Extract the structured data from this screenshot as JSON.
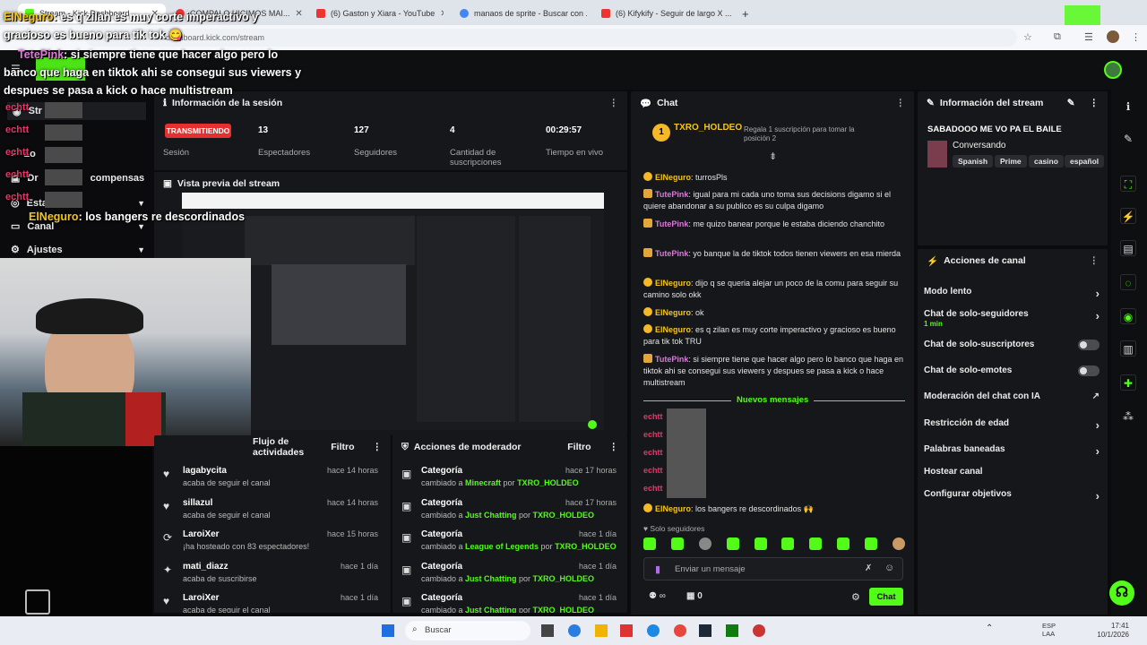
{
  "browser": {
    "tabs": [
      {
        "label": "Stream - Kick Dashboard",
        "color": "#53fc18"
      },
      {
        "label": "COMPALO HICIMOS MAI...",
        "color": "#e33"
      },
      {
        "label": "(6) Gaston y Xiara - YouTube",
        "color": "#e33"
      },
      {
        "label": "manaos de sprite - Buscar con ...",
        "color": "#4285f4"
      },
      {
        "label": "(6) Kifykify - Seguir de largo X ...",
        "color": "#e33"
      }
    ],
    "new_tab": "+",
    "url": "dashboard.kick.com/stream"
  },
  "overlay": {
    "line1_user": "ElNeguro",
    "line1_text": ": es q zilan es muy corte imperactivo y",
    "line2_text": "gracioso es bueno para tik tok",
    "line3_user": "TetePink",
    "line3_text": ": si siempre tiene que hacer algo pero lo",
    "line4_text": "banco que haga en tiktok ahi se consegui sus viewers y",
    "line5_text": "despues se pasa a kick o hace multistream",
    "line6_user": "ElNeguro",
    "line6_text": ": los bangers re descordinados",
    "spam_user": "echtt"
  },
  "leftnav": {
    "items": [
      {
        "label": "Str"
      },
      {
        "label": "Lo"
      },
      {
        "label": "Dr",
        "suffix": "compensas"
      },
      {
        "label": "Estado"
      },
      {
        "label": "Canal"
      },
      {
        "label": "Ajustes"
      }
    ]
  },
  "session": {
    "title": "Información de la sesión",
    "live_badge": "TRANSMITIENDO",
    "live_label": "Sesión",
    "stats": [
      {
        "value": "13",
        "label": "Espectadores"
      },
      {
        "value": "127",
        "label": "Seguidores"
      },
      {
        "value": "4",
        "label": "Cantidad de suscripciones"
      },
      {
        "value": "00:29:57",
        "label": "Tiempo en vivo"
      }
    ]
  },
  "preview": {
    "title": "Vista previa del stream"
  },
  "activity": {
    "title": "Flujo de actividades",
    "filter": "Filtro",
    "rows": [
      {
        "icon": "heart-icon",
        "glyph": "♥",
        "who": "lagabycita",
        "desc": "acaba de seguir el canal",
        "when": "hace 14 horas"
      },
      {
        "icon": "heart-icon",
        "glyph": "♥",
        "who": "sillazul",
        "desc": "acaba de seguir el canal",
        "when": "hace 14 horas"
      },
      {
        "icon": "host-icon",
        "glyph": "⟳",
        "who": "LaroiXer",
        "desc": "¡ha hosteado con 83 espectadores!",
        "when": "hace 15 horas"
      },
      {
        "icon": "star-icon",
        "glyph": "✦",
        "who": "mati_diazz",
        "desc": "acaba de suscribirse",
        "when": "hace 1 día"
      },
      {
        "icon": "heart-icon",
        "glyph": "♥",
        "who": "LaroiXer",
        "desc": "acaba de seguir el canal",
        "when": "hace 1 día"
      }
    ]
  },
  "modactions": {
    "title": "Acciones de moderador",
    "filter": "Filtro",
    "rows": [
      {
        "who": "Categoría",
        "desc1": "cambiado a",
        "cat": "Minecraft",
        "desc2": "por",
        "mod": "TXRO_HOLDEO",
        "when": "hace 17 horas"
      },
      {
        "who": "Categoría",
        "desc1": "cambiado a",
        "cat": "Just Chatting",
        "desc2": "por",
        "mod": "TXRO_HOLDEO",
        "when": "hace 17 horas"
      },
      {
        "who": "Categoría",
        "desc1": "cambiado a",
        "cat": "League of Legends",
        "desc2": "por",
        "mod": "TXRO_HOLDEO",
        "when": "hace 1 día"
      },
      {
        "who": "Categoría",
        "desc1": "cambiado a",
        "cat": "Just Chatting",
        "desc2": "por",
        "mod": "TXRO_HOLDEO",
        "when": "hace 1 día"
      },
      {
        "who": "Categoría",
        "desc1": "cambiado a",
        "cat": "Just Chatting",
        "desc2": "por",
        "mod": "TXRO_HOLDEO",
        "when": "hace 1 día"
      }
    ]
  },
  "chat": {
    "title": "Chat",
    "pinned_rank": "1",
    "pinned_user": "TXRO_HOLDEO",
    "gift_text": "Regala 1 suscripción para tomar la posición 2",
    "messages": [
      {
        "badge": "circle",
        "user": "ElNeguro",
        "cls": "u-y",
        "text": ": turrosPls"
      },
      {
        "badge": "square",
        "user": "TutePink",
        "cls": "u-p",
        "text": ": igual para mi cada uno toma sus decisions digamo si el quiere abandonar a su publico es su culpa digamo"
      },
      {
        "badge": "square",
        "user": "TutePink",
        "cls": "u-p",
        "text": ": me quizo banear porque le estaba diciendo chanchito"
      },
      {
        "badge": "square",
        "user": "TutePink",
        "cls": "u-p",
        "text": ": yo banque la de tiktok todos tienen viewers en esa mierda"
      },
      {
        "badge": "circle",
        "user": "ElNeguro",
        "cls": "u-y",
        "text": ": dijo q se queria alejar un poco de la comu para seguir su camino solo okk"
      },
      {
        "badge": "circle",
        "user": "ElNeguro",
        "cls": "u-y",
        "text": ": ok"
      },
      {
        "badge": "circle",
        "user": "ElNeguro",
        "cls": "u-y",
        "text": ": es q zilan es muy corte imperactivo y gracioso es bueno para tik tok TRU"
      },
      {
        "badge": "square",
        "user": "TutePink",
        "cls": "u-p",
        "text": ": si siempre tiene que hacer algo pero lo banco que haga en tiktok ahi se consegui sus viewers y despues se pasa a kick o hace multistream"
      }
    ],
    "new_messages": "Nuevos mensajes",
    "spam_user": "echtt",
    "last_user": "ElNeguro",
    "last_text": ": los bangers re descordinados",
    "followers_only": "Solo seguidores",
    "input_placeholder": "Enviar un mensaje",
    "points": "∞",
    "gifts": "0",
    "send": "Chat"
  },
  "streaminfo": {
    "title": "Información del stream",
    "stream_title": "SABADOOO ME VO PA EL BAILE",
    "category": "Conversando",
    "tags": [
      "Spanish",
      "Prime",
      "casino",
      "español"
    ]
  },
  "channel": {
    "title": "Acciones de canal",
    "items": [
      {
        "label": "Modo lento",
        "type": "chevron",
        "sub": ""
      },
      {
        "label": "Chat de solo-seguidores",
        "type": "chevron",
        "sub": "1 min"
      },
      {
        "label": "Chat de solo-suscriptores",
        "type": "toggle",
        "sub": ""
      },
      {
        "label": "Chat de solo-emotes",
        "type": "toggle",
        "sub": ""
      },
      {
        "label": "Moderación del chat con IA",
        "type": "external",
        "sub": ""
      },
      {
        "label": "Restricción de edad",
        "type": "chevron",
        "sub": ""
      },
      {
        "label": "Palabras baneadas",
        "type": "chevron",
        "sub": ""
      },
      {
        "label": "Hostear canal",
        "type": "none",
        "sub": ""
      },
      {
        "label": "Configurar objetivos",
        "type": "chevron",
        "sub": ""
      }
    ]
  },
  "taskbar": {
    "search": "Buscar",
    "lang1": "ESP",
    "lang2": "LAA",
    "time": "17:41",
    "date": "10/1/2026"
  },
  "colors": {
    "kick_green": "#53fc18",
    "panel": "#16171a",
    "bg": "#0b0b0d",
    "gold": "#f5b827"
  }
}
